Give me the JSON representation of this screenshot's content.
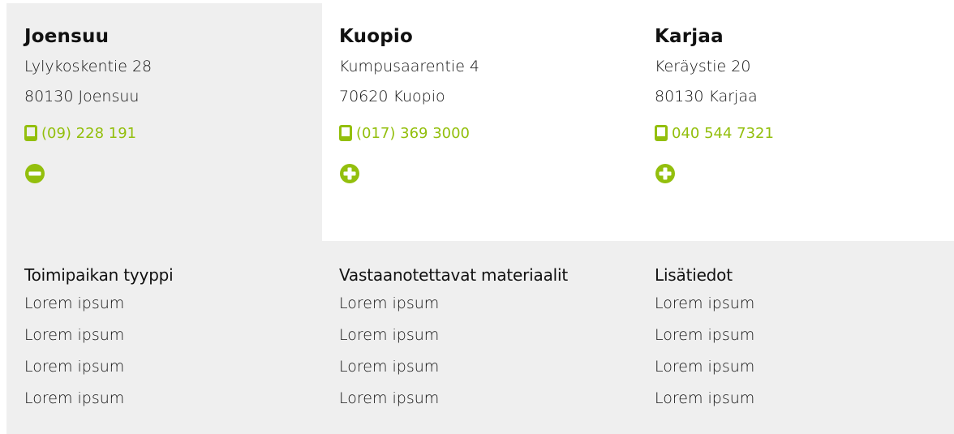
{
  "locations": [
    {
      "name": "Joensuu",
      "street": "Lylykoskentie 28",
      "city": "80130 Joensuu",
      "phone": "(09) 228 191",
      "expanded": true
    },
    {
      "name": "Kuopio",
      "street": "Kumpusaarentie 4",
      "city": "70620 Kuopio",
      "phone": "(017) 369 3000",
      "expanded": false
    },
    {
      "name": "Karjaa",
      "street": "Keräystie 20",
      "city": "80130 Karjaa",
      "phone": "040 544 7321",
      "expanded": false
    }
  ],
  "details": [
    {
      "heading": "Toimipaikan tyyppi",
      "items": [
        "Lorem ipsum",
        "Lorem ipsum",
        "Lorem ipsum",
        "Lorem ipsum"
      ]
    },
    {
      "heading": "Vastaanotettavat materiaalit",
      "items": [
        "Lorem ipsum",
        "Lorem ipsum",
        "Lorem ipsum",
        "Lorem ipsum"
      ]
    },
    {
      "heading": "Lisätiedot",
      "items": [
        "Lorem ipsum",
        "Lorem ipsum",
        "Lorem ipsum",
        "Lorem ipsum"
      ]
    }
  ],
  "colors": {
    "accent": "#93bf0d",
    "panel_bg": "#efefef",
    "text": "#111111"
  },
  "icons": {
    "phone": "mobile-phone-icon",
    "expanded": "minus-circle-icon",
    "collapsed": "plus-circle-icon"
  }
}
